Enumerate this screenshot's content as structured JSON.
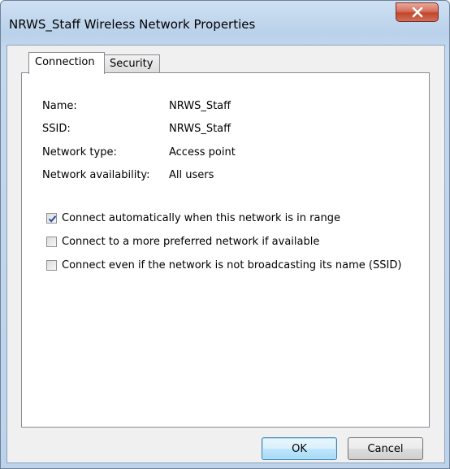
{
  "window": {
    "title": "NRWS_Staff Wireless Network Properties"
  },
  "tabs": [
    {
      "label": "Connection",
      "selected": true
    },
    {
      "label": "Security",
      "selected": false
    }
  ],
  "info": [
    {
      "label": "Name:",
      "value": "NRWS_Staff"
    },
    {
      "label": "SSID:",
      "value": "NRWS_Staff"
    },
    {
      "label": "Network type:",
      "value": "Access point"
    },
    {
      "label": "Network availability:",
      "value": "All users"
    }
  ],
  "options": [
    {
      "label": "Connect automatically when this network is in range",
      "checked": true
    },
    {
      "label": "Connect to a more preferred network if available",
      "checked": false
    },
    {
      "label": "Connect even if the network is not broadcasting its name (SSID)",
      "checked": false
    }
  ],
  "buttons": {
    "ok": "OK",
    "cancel": "Cancel"
  },
  "icons": {
    "close": "close-icon",
    "check": "checkmark-icon"
  },
  "colors": {
    "close_button": "#c14529",
    "titlebar": "#b9d1ea",
    "checkmark": "#2b4fa0"
  }
}
